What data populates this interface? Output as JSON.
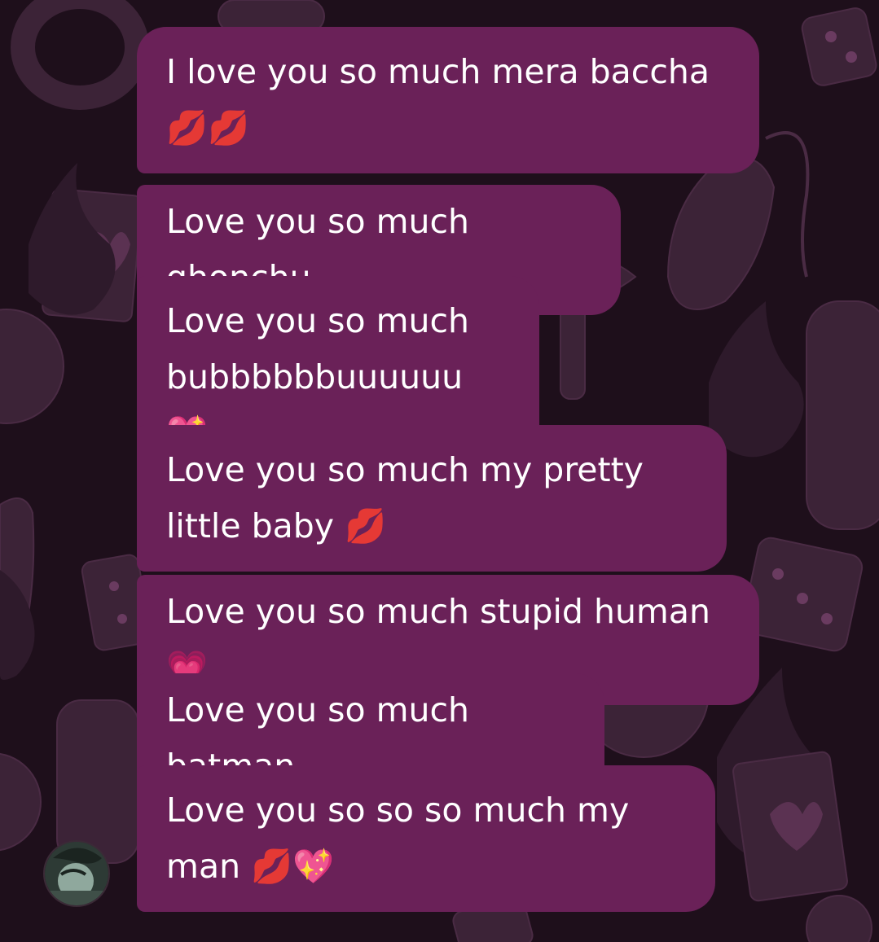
{
  "chat": {
    "messages": [
      {
        "text": "I love you so much mera baccha 💋💋"
      },
      {
        "text": "Love you so much ghonchu"
      },
      {
        "text": "Love you so much bubbbbbbuuuuuu 💖"
      },
      {
        "text": "Love you so much my pretty little baby 💋"
      },
      {
        "text": "Love you so much stupid human 💗"
      },
      {
        "text": "Love you so much batman"
      },
      {
        "text": "Love you so so so much my man 💋💖"
      }
    ]
  },
  "theme": {
    "bubble_color": "#6a2158",
    "background_color": "#1e0f1b",
    "pattern_color": "#3c2337",
    "text_color": "#ffffff"
  },
  "avatar": {
    "icon": "sender-avatar"
  }
}
